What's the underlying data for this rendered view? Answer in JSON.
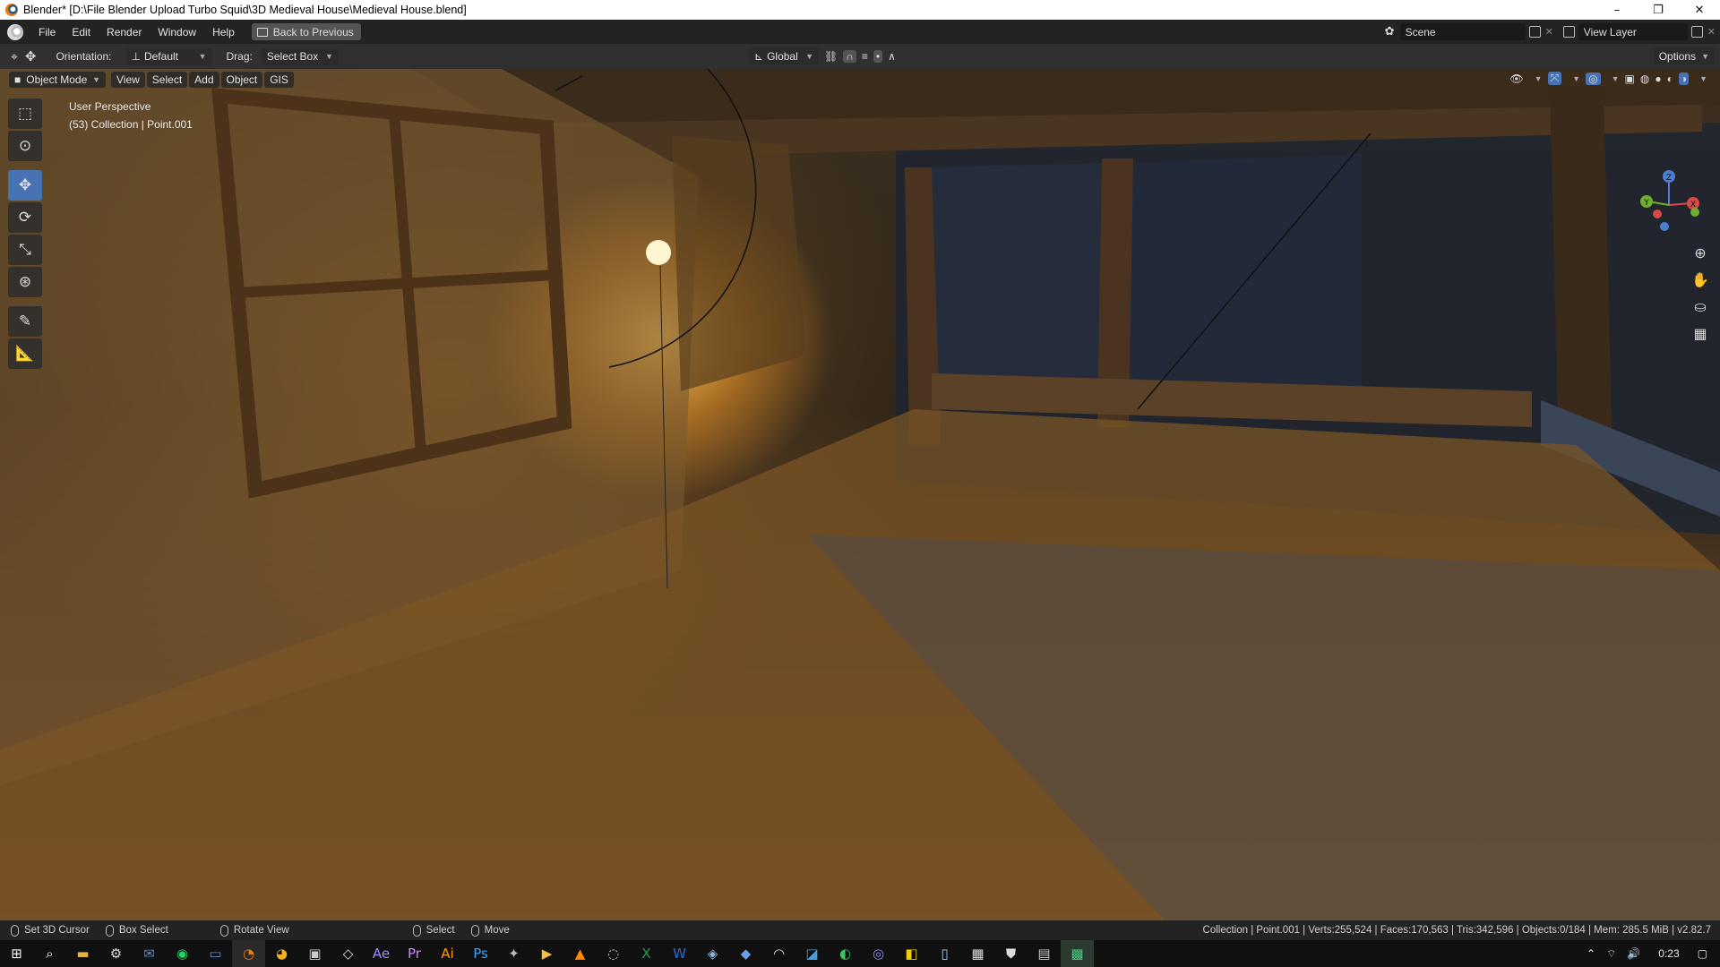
{
  "window": {
    "title": "Blender* [D:\\File Blender Upload Turbo Squid\\3D Medieval House\\Medieval House.blend]",
    "controls": [
      "–",
      "❐",
      "✕"
    ]
  },
  "menu": {
    "items": [
      "File",
      "Edit",
      "Render",
      "Window",
      "Help"
    ],
    "back_label": "Back to Previous",
    "scene_name": "Scene",
    "view_layer": "View Layer"
  },
  "toolheader": {
    "orientation_label": "Orientation:",
    "orientation_value": "Default",
    "drag_label": "Drag:",
    "drag_value": "Select Box",
    "transform_orientation": "Global",
    "options_label": "Options"
  },
  "viewport_header": {
    "mode": "Object Mode",
    "menus": [
      "View",
      "Select",
      "Add",
      "Object",
      "GIS"
    ]
  },
  "viewport": {
    "perspective": "User Perspective",
    "collection_info": "(53) Collection | Point.001"
  },
  "gizmo": {
    "x": "X",
    "y": "Y",
    "z": "Z"
  },
  "toolbar": {
    "tools": [
      "select-box",
      "cursor",
      "move",
      "rotate",
      "scale",
      "transform",
      "annotate",
      "measure"
    ]
  },
  "statusbar": {
    "set_cursor": "Set 3D Cursor",
    "box_select": "Box Select",
    "rotate_view": "Rotate View",
    "select": "Select",
    "move": "Move",
    "stats": "Collection | Point.001 | Verts:255,524 | Faces:170,563 | Tris:342,596 | Objects:0/184 | Mem: 285.5 MiB | v2.82.7"
  },
  "taskbar": {
    "clock": "0:23",
    "apps": [
      "start",
      "search",
      "explorer",
      "settings",
      "mail",
      "whatsapp",
      "chat",
      "blender",
      "chrome",
      "terminal",
      "unity",
      "after-effects",
      "premiere",
      "illustrator",
      "photoshop",
      "rhino",
      "media",
      "vlc",
      "obs",
      "excel",
      "word",
      "steam",
      "app1",
      "app2",
      "app3",
      "app4",
      "app5",
      "app6",
      "calculator",
      "app7",
      "app8",
      "active-app"
    ]
  },
  "colors": {
    "accent": "#4772b3",
    "title_bg": "#ffffff",
    "menu_bg": "#232323",
    "header_bg": "#303030"
  }
}
